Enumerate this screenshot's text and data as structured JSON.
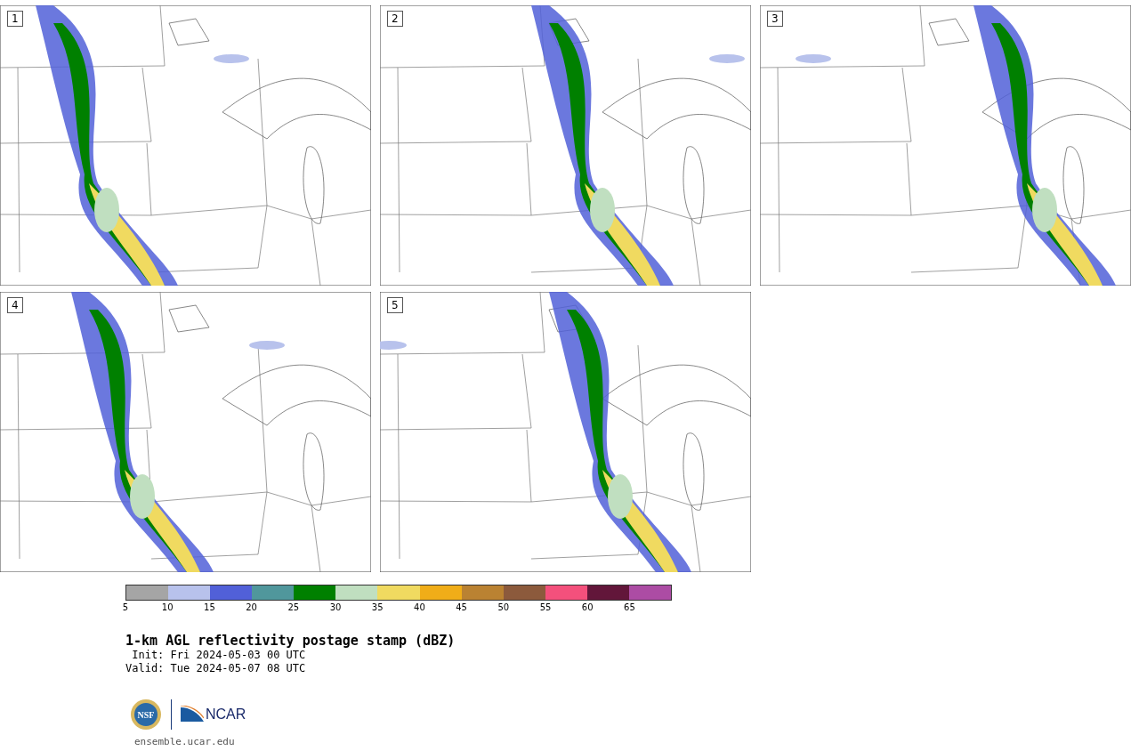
{
  "panels": [
    {
      "label": "1"
    },
    {
      "label": "2"
    },
    {
      "label": "3"
    },
    {
      "label": "4"
    },
    {
      "label": "5"
    }
  ],
  "colorbar": {
    "bins": [
      {
        "color": "#a5a5a5"
      },
      {
        "color": "#b8c2ec"
      },
      {
        "color": "#5160d8"
      },
      {
        "color": "#50979c"
      },
      {
        "color": "#008000"
      },
      {
        "color": "#c0dfc0"
      },
      {
        "color": "#f0da60"
      },
      {
        "color": "#f0ad18"
      },
      {
        "color": "#ba8232"
      },
      {
        "color": "#8c5a3c"
      },
      {
        "color": "#f4507c"
      },
      {
        "color": "#62163a"
      },
      {
        "color": "#ac4ca4"
      }
    ],
    "ticks": [
      "5",
      "10",
      "15",
      "20",
      "25",
      "30",
      "35",
      "40",
      "45",
      "50",
      "55",
      "60",
      "65"
    ]
  },
  "title": "1-km AGL reflectivity postage stamp (dBZ)",
  "init": " Init: Fri 2024-05-03 00 UTC",
  "valid": "Valid: Tue 2024-05-07 08 UTC",
  "logo": {
    "left": "NSF",
    "right": "NCAR"
  },
  "url": "ensemble.ucar.edu"
}
